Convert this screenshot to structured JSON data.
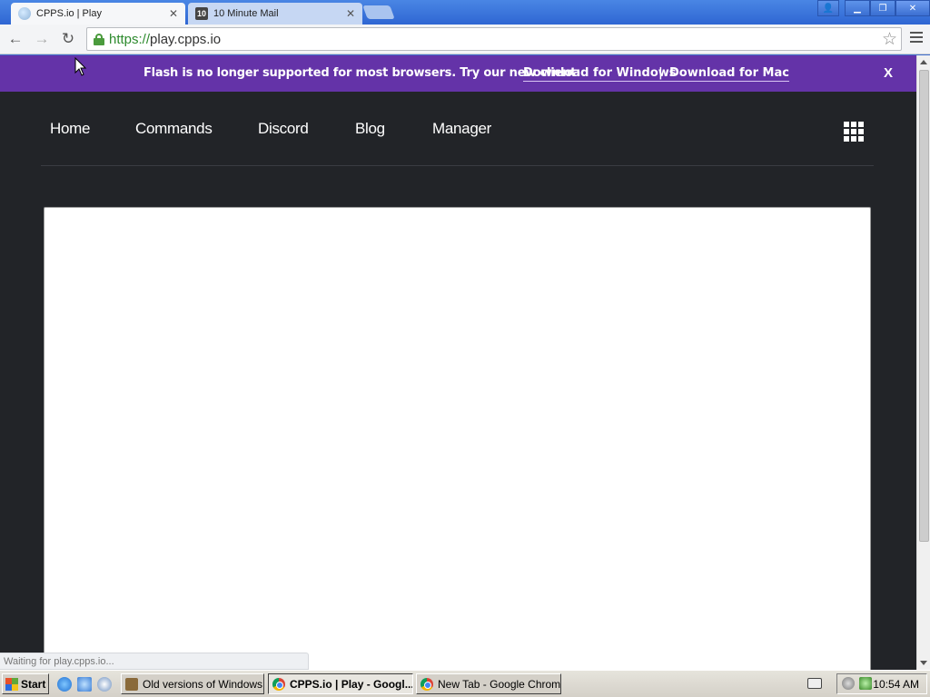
{
  "browser": {
    "tabs": [
      {
        "title": "CPPS.io | Play",
        "active": true
      },
      {
        "title": "10 Minute Mail",
        "active": false,
        "favicon_text": "10"
      }
    ],
    "close_glyph": "✕",
    "window_buttons": {
      "user": "👤",
      "minimize": "▁",
      "restore": "❐",
      "close": "✕"
    },
    "address": {
      "scheme": "https://",
      "host": "play.cpps.io"
    },
    "status_text": "Waiting for play.cpps.io..."
  },
  "page": {
    "banner": {
      "message": "Flash is no longer supported for most browsers. Try our new client:",
      "download_windows": "Download for Windows",
      "separator": "|",
      "download_mac": "Download for Mac",
      "close": "X",
      "color": "#6433a8"
    },
    "nav": {
      "items": [
        "Home",
        "Commands",
        "Discord",
        "Blog",
        "Manager"
      ]
    },
    "background_color": "#222428"
  },
  "taskbar": {
    "start_label": "Start",
    "tasks": [
      {
        "label": "Old versions of Windows...",
        "pressed": false
      },
      {
        "label": "CPPS.io | Play - Googl...",
        "pressed": true
      },
      {
        "label": "New Tab - Google Chrome",
        "pressed": false
      }
    ],
    "clock": "10:54 AM"
  }
}
